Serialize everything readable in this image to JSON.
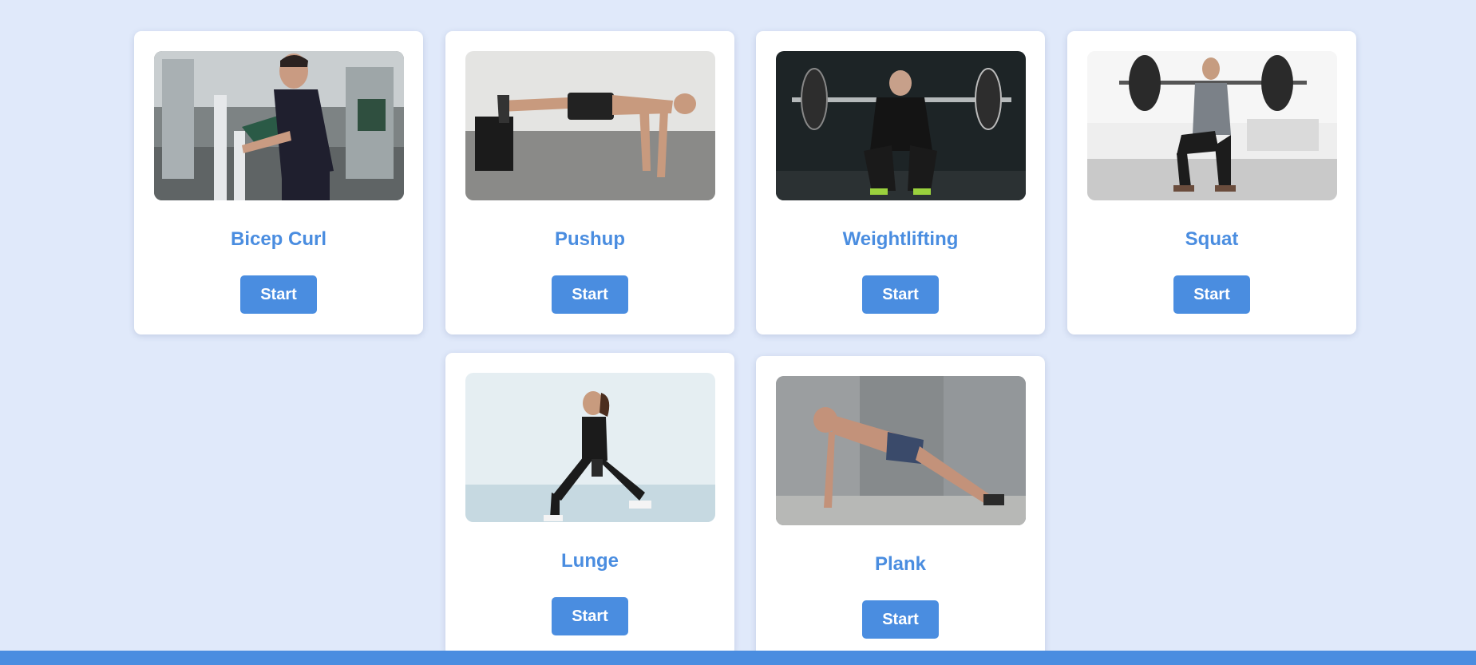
{
  "theme": {
    "background": "#e0e9fa",
    "accent": "#4a8de0",
    "card": "#ffffff"
  },
  "exercises": [
    {
      "title": "Bicep Curl",
      "button": "Start",
      "photo": "man-on-preacher-curl-machine-in-gym"
    },
    {
      "title": "Pushup",
      "button": "Start",
      "photo": "man-doing-decline-pushup-feet-on-box"
    },
    {
      "title": "Weightlifting",
      "button": "Start",
      "photo": "man-squatting-with-barbell-dark-gym"
    },
    {
      "title": "Squat",
      "button": "Start",
      "photo": "man-barbell-back-squat-bright-studio"
    },
    {
      "title": "Lunge",
      "button": "Start",
      "photo": "woman-lunging-with-dumbbells"
    },
    {
      "title": "Plank",
      "button": "Start",
      "photo": "man-side-plank-outdoors"
    }
  ]
}
